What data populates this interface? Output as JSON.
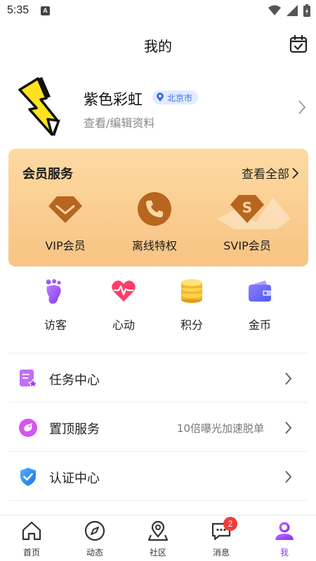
{
  "status_bar": {
    "time": "5:35",
    "notification_letter": "A"
  },
  "header": {
    "title": "我的",
    "calendar_icon": "calendar-check-icon"
  },
  "profile": {
    "nickname": "紫色彩虹",
    "location": "北京市",
    "edit_label": "查看/编辑资料"
  },
  "vip_card": {
    "title": "会员服务",
    "view_all": "查看全部",
    "items": [
      {
        "label": "VIP会员",
        "icon": "vip-diamond-icon"
      },
      {
        "label": "离线特权",
        "icon": "phone-icon"
      },
      {
        "label": "SVIP会员",
        "icon": "svip-diamond-icon"
      }
    ]
  },
  "quick_actions": [
    {
      "label": "访客",
      "icon": "footprint-icon"
    },
    {
      "label": "心动",
      "icon": "heartbeat-icon"
    },
    {
      "label": "积分",
      "icon": "coins-icon"
    },
    {
      "label": "金币",
      "icon": "wallet-icon"
    }
  ],
  "menu": [
    {
      "label": "任务中心",
      "hint": "",
      "icon": "task-list-icon"
    },
    {
      "label": "置顶服务",
      "hint": "10倍曝光加速脱单",
      "icon": "pin-bird-icon"
    },
    {
      "label": "认证中心",
      "hint": "",
      "icon": "shield-check-icon"
    }
  ],
  "tabbar": {
    "tabs": [
      {
        "label": "首页",
        "icon": "home-icon"
      },
      {
        "label": "动态",
        "icon": "compass-icon"
      },
      {
        "label": "社区",
        "icon": "map-pin-icon"
      },
      {
        "label": "消息",
        "icon": "chat-icon",
        "badge": "2"
      },
      {
        "label": "我",
        "icon": "user-icon",
        "active": true
      }
    ]
  },
  "colors": {
    "accent": "#8a3df0",
    "vip_gold": "#f7c382",
    "vip_icon": "#b8651f",
    "badge": "#f23b3b",
    "location": "#3d6ee8"
  }
}
